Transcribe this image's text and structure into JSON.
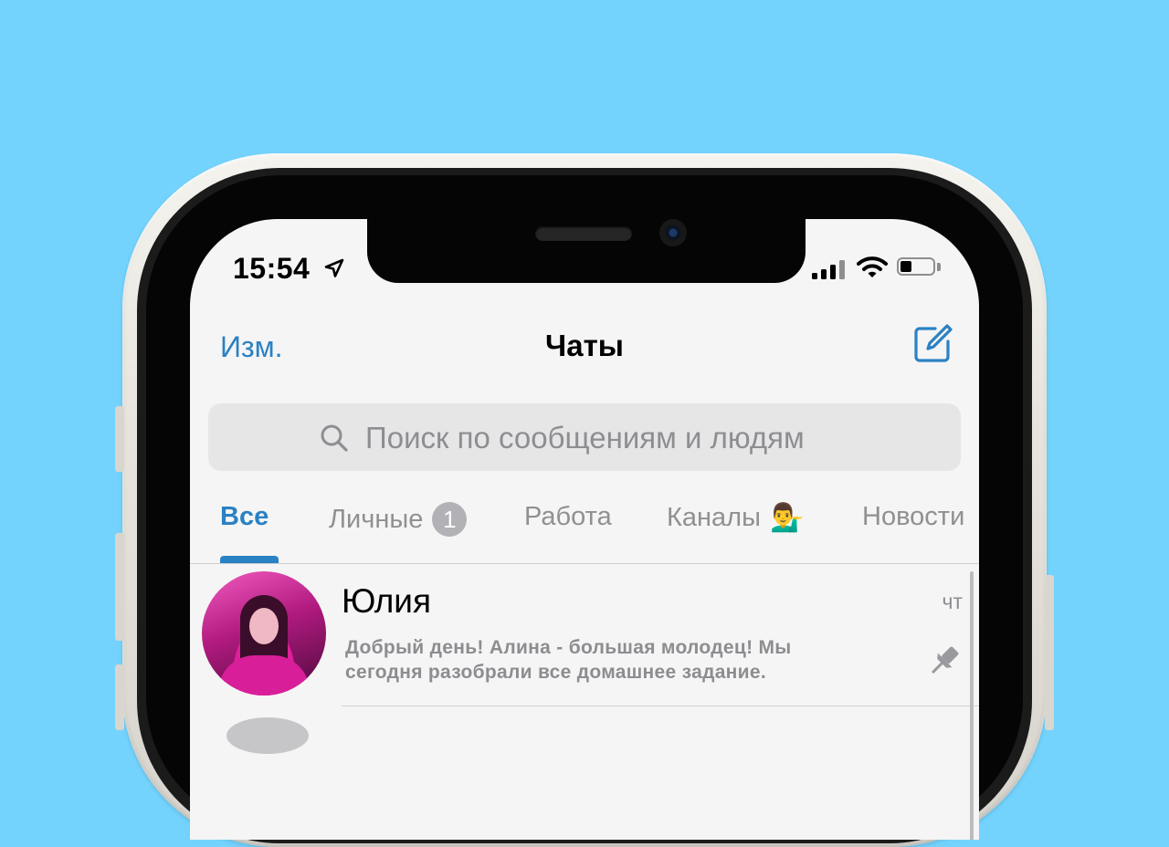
{
  "status_bar": {
    "time": "15:54",
    "location_icon": "location-arrow-icon",
    "signal_icon": "signal-bars-icon",
    "wifi_icon": "wifi-icon",
    "battery_icon": "battery-icon",
    "battery_level": 0.25
  },
  "nav": {
    "edit_label": "Изм.",
    "title": "Чаты",
    "compose_icon": "compose-icon"
  },
  "search": {
    "placeholder": "Поиск по сообщениям и людям",
    "value": "",
    "icon": "search-icon"
  },
  "tabs": [
    {
      "label": "Все",
      "active": true
    },
    {
      "label": "Личные",
      "badge": "1"
    },
    {
      "label": "Работа"
    },
    {
      "label": "Каналы",
      "emoji": "💁‍♂️"
    },
    {
      "label": "Новости"
    }
  ],
  "chats": [
    {
      "name": "Юлия",
      "time": "чт",
      "message": "Добрый день! Алина - большая молодец! Мы сегодня разобрали все домашнее задание.",
      "pinned": true,
      "pin_icon": "pin-icon"
    }
  ],
  "colors": {
    "accent": "#2a81c3",
    "background": "#73d3fd",
    "screen": "#f5f5f5"
  }
}
